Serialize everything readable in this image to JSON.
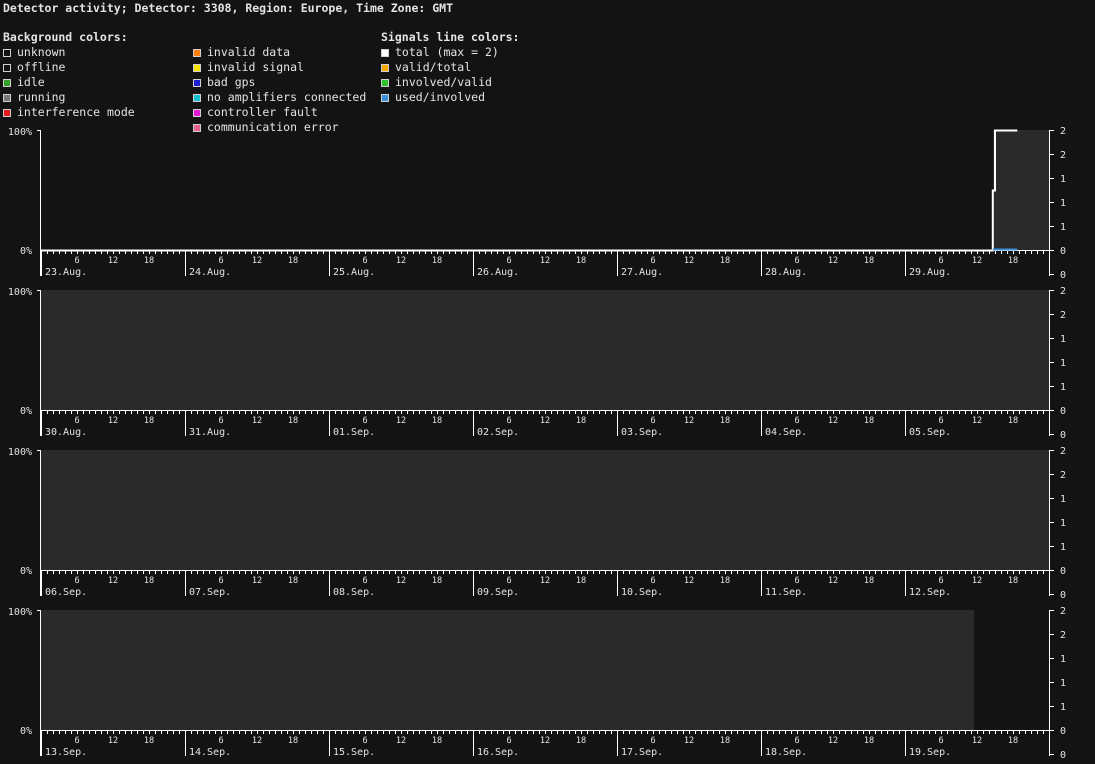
{
  "title": "Detector activity; Detector: 3308, Region: Europe, Time Zone: GMT",
  "legend": {
    "background_header": "Background colors:",
    "signals_header": "Signals line colors:",
    "background_items": [
      {
        "label": "unknown",
        "color": "#131313"
      },
      {
        "label": "offline",
        "color": "#131313"
      },
      {
        "label": "idle",
        "color": "#33a02c"
      },
      {
        "label": "running",
        "color": "#777777"
      },
      {
        "label": "interference mode",
        "color": "#e41a1c"
      },
      {
        "label": "invalid data",
        "color": "#ff7f0e"
      },
      {
        "label": "invalid signal",
        "color": "#f5e400"
      },
      {
        "label": "bad gps",
        "color": "#1f1fd0"
      },
      {
        "label": "no amplifiers connected",
        "color": "#17becf"
      },
      {
        "label": "controller fault",
        "color": "#e21ad6"
      },
      {
        "label": "communication error",
        "color": "#e8618c"
      }
    ],
    "signal_items": [
      {
        "label": "total (max = 2)",
        "color": "#ffffff"
      },
      {
        "label": "valid/total",
        "color": "#f5a800"
      },
      {
        "label": "involved/valid",
        "color": "#2ec02e"
      },
      {
        "label": "used/involved",
        "color": "#3a8fd8"
      }
    ]
  },
  "chart_data": {
    "type": "area",
    "left_axis": {
      "labels": [
        "100%",
        "0%"
      ]
    },
    "right_axis": {
      "labels": [
        "2",
        "2",
        "1",
        "1",
        "1",
        "0",
        "0"
      ]
    },
    "hour_ticks": [
      "6",
      "12",
      "18"
    ],
    "colors": {
      "running_fill": "#2a2a2a",
      "axis": "#ffffff",
      "total_line": "#ffffff",
      "used_line": "#3a8fd8"
    },
    "rows": [
      {
        "days": [
          "23.Aug.",
          "24.Aug.",
          "25.Aug.",
          "26.Aug.",
          "27.Aug.",
          "28.Aug.",
          "29.Aug."
        ],
        "running": [
          [
            6.61,
            7.0
          ]
        ],
        "total_line": [
          [
            0,
            0
          ],
          [
            6.61,
            0
          ],
          [
            6.61,
            1
          ],
          [
            6.625,
            1
          ],
          [
            6.625,
            2
          ],
          [
            6.78,
            2
          ]
        ],
        "used_line": [
          [
            6.61,
            0
          ],
          [
            6.78,
            0
          ]
        ]
      },
      {
        "days": [
          "30.Aug.",
          "31.Aug.",
          "01.Sep.",
          "02.Sep.",
          "03.Sep.",
          "04.Sep.",
          "05.Sep."
        ],
        "running": [
          [
            0,
            7.0
          ]
        ],
        "total_line": [],
        "used_line": []
      },
      {
        "days": [
          "06.Sep.",
          "07.Sep.",
          "08.Sep.",
          "09.Sep.",
          "10.Sep.",
          "11.Sep.",
          "12.Sep."
        ],
        "running": [
          [
            0,
            7.0
          ]
        ],
        "total_line": [],
        "used_line": []
      },
      {
        "days": [
          "13.Sep.",
          "14.Sep.",
          "15.Sep.",
          "16.Sep.",
          "17.Sep.",
          "18.Sep.",
          "19.Sep."
        ],
        "running": [
          [
            0,
            6.48
          ]
        ],
        "total_line": [],
        "used_line": []
      }
    ]
  }
}
